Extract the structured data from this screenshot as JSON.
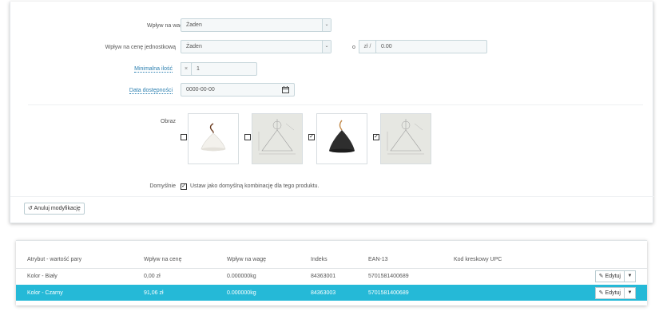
{
  "form": {
    "weight_impact": {
      "label": "Wpływ na wagę",
      "value": "Żaden"
    },
    "unit_price_impact": {
      "label": "Wpływ na cenę jednostkową",
      "value": "Żaden",
      "o_label": "o",
      "unit": "zł /",
      "amount": "0.00"
    },
    "min_quantity": {
      "label": "Minimalna ilość",
      "prefix": "×",
      "value": "1"
    },
    "availability_date": {
      "label": "Data dostępności",
      "value": "0000-00-00"
    },
    "images": {
      "label": "Obraz",
      "items": [
        {
          "name": "white-lamp-photo",
          "checked": false
        },
        {
          "name": "white-lamp-sketch",
          "checked": false
        },
        {
          "name": "black-lamp-photo",
          "checked": true
        },
        {
          "name": "black-lamp-sketch",
          "checked": true
        }
      ]
    },
    "default": {
      "label": "Domyślnie",
      "checkbox_text": "Ustaw jako domyślną kombinację dla tego produktu.",
      "checked": true
    },
    "cancel_button": "Anuluj modyfikację"
  },
  "table": {
    "headers": [
      "Atrybut - wartość pary",
      "Wpływ na cenę",
      "Wpływ na wagę",
      "Indeks",
      "EAN-13",
      "Kod kreskowy UPC"
    ],
    "rows": [
      {
        "attribute": "Kolor - Biały",
        "price": "0,00 zł",
        "weight": "0.000000kg",
        "index": "84363001",
        "ean": "5701581400689",
        "upc": "",
        "active": false
      },
      {
        "attribute": "Kolor - Czarny",
        "price": "91,06 zł",
        "weight": "0.000000kg",
        "index": "84363003",
        "ean": "5701581400689",
        "upc": "",
        "active": true
      }
    ],
    "edit_label": "Edytuj"
  },
  "colors": {
    "accent": "#25b9d7",
    "label_required": "#2a7fb0"
  }
}
